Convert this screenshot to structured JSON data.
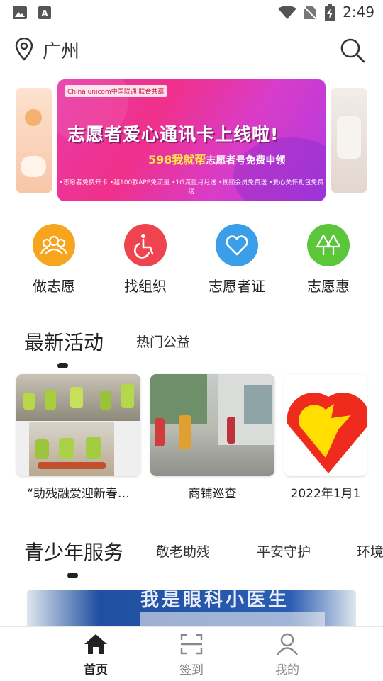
{
  "status_bar": {
    "time": "2:49"
  },
  "header": {
    "city": "广州"
  },
  "banner": {
    "title": "志愿者爱心通讯卡上线啦!",
    "subtitle_highlight": "598我就帮",
    "subtitle_rest": "志愿者号免费申领",
    "footer": "•志愿者免费开卡 •超100款APP免流量 •1G流量月月送 •视频会员免费送 •爱心关怀礼包免费送",
    "logo": "China unicom中国联通 联合共赢"
  },
  "quick_entries": [
    {
      "label": "做志愿",
      "icon": "people-icon",
      "color": "#f7a51c"
    },
    {
      "label": "找组织",
      "icon": "wheelchair-icon",
      "color": "#ef4450"
    },
    {
      "label": "志愿者证",
      "icon": "heart-icon",
      "color": "#3a9ee8"
    },
    {
      "label": "志愿惠",
      "icon": "trees-icon",
      "color": "#5cc63a"
    }
  ],
  "activities_section": {
    "tabs": [
      "最新活动",
      "热门公益"
    ],
    "cards": [
      {
        "title": "“助残融爱迎新春…"
      },
      {
        "title": "商铺巡查"
      },
      {
        "title": "2022年1月1"
      }
    ]
  },
  "service_section": {
    "tabs": [
      "青少年服务",
      "敬老助残",
      "平安守护",
      "环境"
    ],
    "banner_text": "我是眼科小医生"
  },
  "bottom_nav": {
    "items": [
      {
        "label": "首页",
        "icon": "home-icon",
        "active": true
      },
      {
        "label": "签到",
        "icon": "scan-icon",
        "active": false
      },
      {
        "label": "我的",
        "icon": "profile-icon",
        "active": false
      }
    ]
  },
  "colors": {
    "active_nav": "#222222",
    "inactive_nav": "#888888"
  }
}
